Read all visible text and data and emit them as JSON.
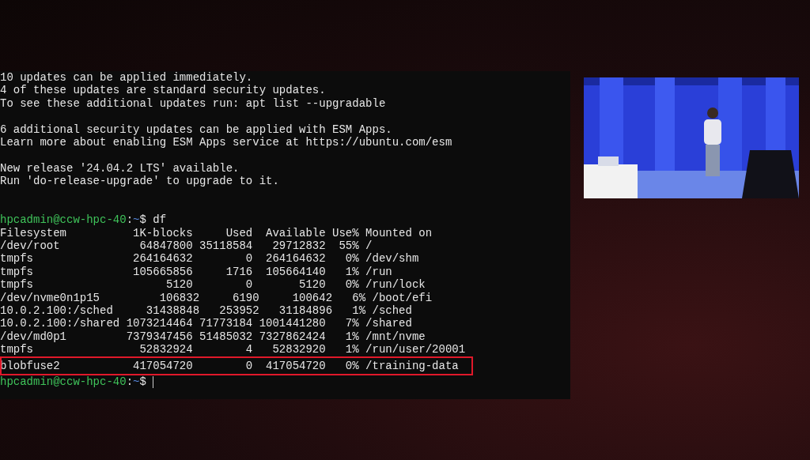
{
  "terminal": {
    "lines": [
      {
        "kind": "text",
        "text": "10 updates can be applied immediately."
      },
      {
        "kind": "text",
        "text": "4 of these updates are standard security updates."
      },
      {
        "kind": "text",
        "text": "To see these additional updates run: apt list --upgradable"
      },
      {
        "kind": "blank"
      },
      {
        "kind": "text",
        "text": "6 additional security updates can be applied with ESM Apps."
      },
      {
        "kind": "text",
        "text": "Learn more about enabling ESM Apps service at https://ubuntu.com/esm"
      },
      {
        "kind": "blank"
      },
      {
        "kind": "text",
        "text": "New release '24.04.2 LTS' available."
      },
      {
        "kind": "text",
        "text": "Run 'do-release-upgrade' to upgrade to it."
      },
      {
        "kind": "blank"
      },
      {
        "kind": "blank"
      },
      {
        "kind": "prompt",
        "user_host": "hpcadmin@ccw-hpc-40",
        "separator": ":",
        "path": "~",
        "symbol": "$",
        "command": "df",
        "cursor": false
      },
      {
        "kind": "text",
        "text": "Filesystem          1K-blocks     Used  Available Use% Mounted on"
      },
      {
        "kind": "text",
        "text": "/dev/root            64847800 35118584   29712832  55% /"
      },
      {
        "kind": "text",
        "text": "tmpfs               264164632        0  264164632   0% /dev/shm"
      },
      {
        "kind": "text",
        "text": "tmpfs               105665856     1716  105664140   1% /run"
      },
      {
        "kind": "text",
        "text": "tmpfs                    5120        0       5120   0% /run/lock"
      },
      {
        "kind": "text",
        "text": "/dev/nvme0n1p15         106832     6190     100642   6% /boot/efi"
      },
      {
        "kind": "text",
        "text": "10.0.2.100:/sched     31438848   253952   31184896   1% /sched"
      },
      {
        "kind": "text",
        "text": "10.0.2.100:/shared 1073214464 71773184 1001441280   7% /shared"
      },
      {
        "kind": "text",
        "text": "/dev/md0p1         7379347456 51485032 7327862424   1% /mnt/nvme"
      },
      {
        "kind": "text",
        "text": "tmpfs                52832924        4   52832920   1% /run/user/20001"
      },
      {
        "kind": "text",
        "text": "blobfuse2           417054720        0  417054720   0% /training-data",
        "highlighted": true
      },
      {
        "kind": "prompt",
        "user_host": "hpcadmin@ccw-hpc-40",
        "separator": ":",
        "path": "~",
        "symbol": "$",
        "cursor": true
      }
    ]
  }
}
